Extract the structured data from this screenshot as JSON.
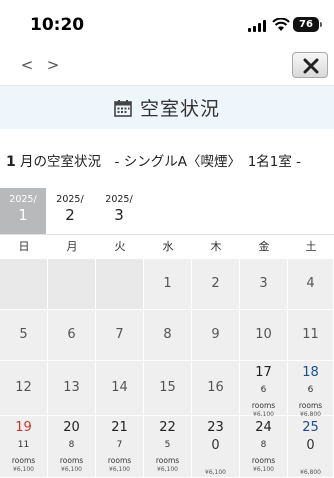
{
  "status": {
    "time": "10:20",
    "battery": "76"
  },
  "nav": {
    "back": "<",
    "forward": ">"
  },
  "header": {
    "title": "空室状況"
  },
  "subtitle": {
    "month": "1",
    "text": " 月の空室状況　-  シングルA〈喫煙〉　1名1室  -"
  },
  "months": [
    {
      "year": "2025/",
      "month": "1",
      "active": true
    },
    {
      "year": "2025/",
      "month": "2",
      "active": false
    },
    {
      "year": "2025/",
      "month": "3",
      "active": false
    }
  ],
  "weekdays": [
    "日",
    "月",
    "火",
    "水",
    "木",
    "金",
    "土"
  ],
  "weeks": [
    [
      {
        "d": ""
      },
      {
        "d": ""
      },
      {
        "d": ""
      },
      {
        "d": "1"
      },
      {
        "d": "2"
      },
      {
        "d": "3"
      },
      {
        "d": "4"
      }
    ],
    [
      {
        "d": "5"
      },
      {
        "d": "6"
      },
      {
        "d": "7"
      },
      {
        "d": "8"
      },
      {
        "d": "9"
      },
      {
        "d": "10"
      },
      {
        "d": "11"
      }
    ],
    [
      {
        "d": "12"
      },
      {
        "d": "13"
      },
      {
        "d": "14"
      },
      {
        "d": "15"
      },
      {
        "d": "16"
      },
      {
        "d": "17",
        "v": "6",
        "u": "rooms",
        "p": "¥6,100",
        "c": "dark"
      },
      {
        "d": "18",
        "v": "6",
        "u": "rooms",
        "p": "¥6,800",
        "c": "blue"
      }
    ],
    [
      {
        "d": "19",
        "v": "11",
        "u": "rooms",
        "p": "¥6,100",
        "c": "red"
      },
      {
        "d": "20",
        "v": "8",
        "u": "rooms",
        "p": "¥6,100",
        "c": "dark"
      },
      {
        "d": "21",
        "v": "7",
        "u": "rooms",
        "p": "¥6,100",
        "c": "dark"
      },
      {
        "d": "22",
        "v": "5",
        "u": "rooms",
        "p": "¥6,100",
        "c": "dark"
      },
      {
        "d": "23",
        "v": "0",
        "u": "",
        "p": "¥6,100",
        "c": "dark",
        "big": true
      },
      {
        "d": "24",
        "v": "8",
        "u": "rooms",
        "p": "¥6,100",
        "c": "dark"
      },
      {
        "d": "25",
        "v": "0",
        "u": "",
        "p": "¥6,800",
        "c": "blue",
        "big": true
      }
    ]
  ]
}
